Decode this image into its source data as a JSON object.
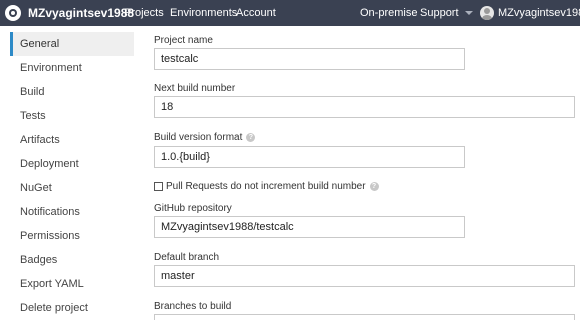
{
  "navbar": {
    "brand": "MZvyagintsev1988",
    "links": [
      "Projects",
      "Environments",
      "Account"
    ],
    "on_premise": "On-premise",
    "support": "Support",
    "user": "MZvyagintsev1988"
  },
  "sidebar": {
    "items": [
      "General",
      "Environment",
      "Build",
      "Tests",
      "Artifacts",
      "Deployment",
      "NuGet",
      "Notifications",
      "Permissions",
      "Badges",
      "Export YAML",
      "Delete project"
    ],
    "active": "General"
  },
  "form": {
    "project_name": {
      "label": "Project name",
      "value": "testcalc"
    },
    "next_build_number": {
      "label": "Next build number",
      "value": "18"
    },
    "build_version_format": {
      "label": "Build version format",
      "value": "1.0.{build}"
    },
    "pull_requests_checkbox": {
      "label": "Pull Requests do not increment build number",
      "checked": false
    },
    "github_repository": {
      "label": "GitHub repository",
      "value": "MZvyagintsev1988/testcalc"
    },
    "default_branch": {
      "label": "Default branch",
      "value": "master"
    },
    "branches_to_build": {
      "label": "Branches to build",
      "value": ""
    }
  },
  "colors": {
    "navbar": "#3a4152",
    "accent": "#2d8ac7",
    "active_background": "#efefef"
  },
  "icons": {
    "brand": "appveyor-logo-icon",
    "help": "question-circle-icon",
    "caret": "caret-down-icon",
    "avatar": "user-avatar-icon"
  }
}
